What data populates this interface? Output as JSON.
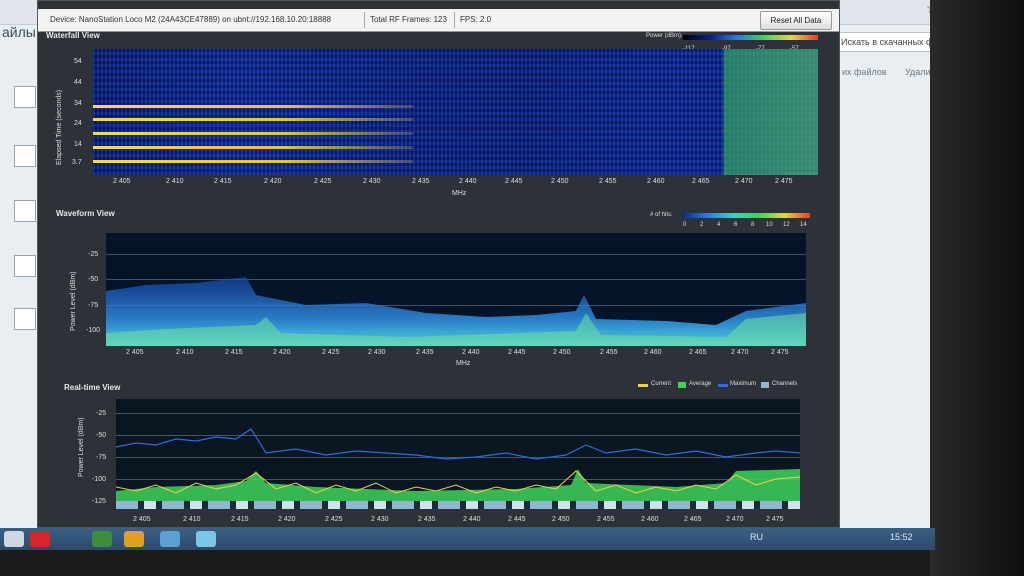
{
  "background": {
    "left_text": "айлы",
    "search_placeholder": "Искать в скачанных файл",
    "link_files": "их файлов",
    "link_delete": "Удалить все"
  },
  "infobar": {
    "device": "Device: NanoStation Loco M2 (24A43CE47889) on ubnt://192.168.10.20:18888",
    "frames": "Total RF Frames: 123",
    "fps": "FPS: 2.0",
    "reset_label": "Reset All Data"
  },
  "waterfall": {
    "title": "Waterfall View",
    "legend_title": "Power (dBm):",
    "legend_ticks": [
      "-117",
      "-97",
      "-77",
      "-57"
    ],
    "y_label": "Elapsed Time (seconds)",
    "y_ticks": [
      "54",
      "44",
      "34",
      "24",
      "14",
      "3.7"
    ],
    "x_label": "MHz"
  },
  "waveform": {
    "title": "Waveform View",
    "legend_title": "# of hits:",
    "legend_ticks": [
      "0",
      "2",
      "4",
      "6",
      "8",
      "10",
      "12",
      "14"
    ],
    "y_label": "Power Level (dBm)",
    "y_ticks": [
      "-25",
      "-50",
      "-75",
      "-100"
    ],
    "x_label": "MHz"
  },
  "realtime": {
    "title": "Real-time View",
    "legend": [
      {
        "name": "Current",
        "color": "#e8d44a"
      },
      {
        "name": "Average",
        "color": "#3fd35a"
      },
      {
        "name": "Maximum",
        "color": "#2c6be0"
      },
      {
        "name": "Channels",
        "color": "#8fb8d0"
      }
    ],
    "y_label": "Power Level (dBm)",
    "y_ticks": [
      "-25",
      "-50",
      "-75",
      "-100",
      "-125"
    ]
  },
  "x_ticks": [
    "2 405",
    "2 410",
    "2 415",
    "2 420",
    "2 425",
    "2 430",
    "2 435",
    "2 440",
    "2 445",
    "2 450",
    "2 455",
    "2 460",
    "2 465",
    "2 470",
    "2 475"
  ],
  "taskbar": {
    "lang": "RU",
    "time": "15:52"
  },
  "colors": {
    "current": "#e8d44a",
    "average": "#3fd35a",
    "maximum": "#2c6be0",
    "panel_bg": "#2d3238"
  }
}
